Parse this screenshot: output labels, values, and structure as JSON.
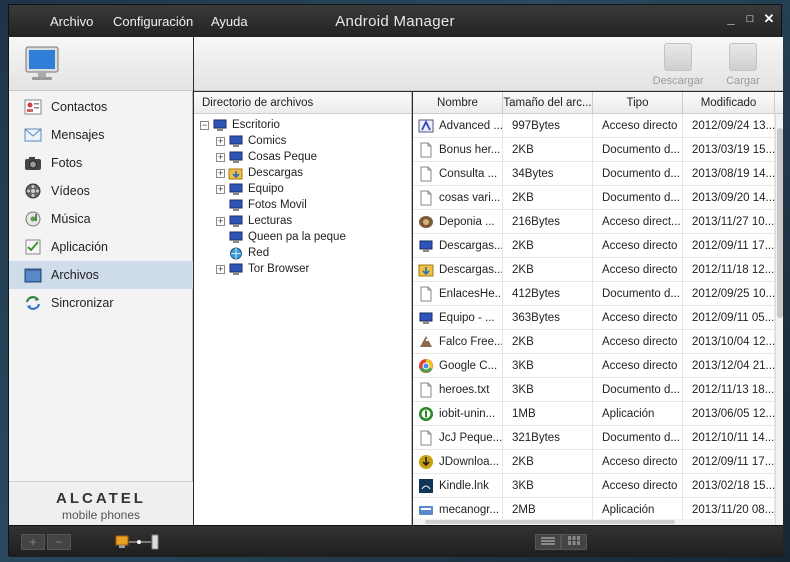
{
  "window": {
    "title": "Android Manager",
    "menu": [
      "Archivo",
      "Configuración",
      "Ayuda"
    ],
    "controls": [
      "_",
      "□",
      "✕"
    ]
  },
  "sidebar": {
    "items": [
      {
        "label": "Contactos",
        "icon": "contacts-icon"
      },
      {
        "label": "Mensajes",
        "icon": "envelope-icon"
      },
      {
        "label": "Fotos",
        "icon": "camera-icon"
      },
      {
        "label": "Vídeos",
        "icon": "film-reel-icon"
      },
      {
        "label": "Música",
        "icon": "music-disc-icon"
      },
      {
        "label": "Aplicación",
        "icon": "checklist-icon"
      },
      {
        "label": "Archivos",
        "icon": "folder-icon",
        "active": true
      },
      {
        "label": "Sincronizar",
        "icon": "sync-icon"
      }
    ],
    "brand": {
      "name": "ALCATEL",
      "sub": "mobile phones"
    }
  },
  "toolbar": {
    "download_label": "Descargar",
    "upload_label": "Cargar"
  },
  "tree": {
    "header": "Directorio de archivos",
    "root": "Escritorio",
    "nodes": [
      {
        "label": "Comics",
        "expandable": true,
        "icon": "computer-icon"
      },
      {
        "label": "Cosas Peque",
        "expandable": true,
        "icon": "computer-icon"
      },
      {
        "label": "Descargas",
        "expandable": true,
        "icon": "folder-download-icon"
      },
      {
        "label": "Equipo",
        "expandable": true,
        "icon": "computer-icon"
      },
      {
        "label": "Fotos Movil",
        "expandable": false,
        "icon": "computer-icon"
      },
      {
        "label": "Lecturas",
        "expandable": true,
        "icon": "computer-icon"
      },
      {
        "label": "Queen pa la peque",
        "expandable": false,
        "icon": "computer-icon"
      },
      {
        "label": "Red",
        "expandable": false,
        "icon": "network-icon"
      },
      {
        "label": "Tor Browser",
        "expandable": true,
        "icon": "computer-icon"
      }
    ]
  },
  "files": {
    "columns": [
      "Nombre",
      "Tamaño del arc...",
      "Tipo",
      "Modificado"
    ],
    "rows": [
      {
        "name": "Advanced ...",
        "size": "997Bytes",
        "type": "Acceso directo",
        "modified": "2012/09/24 13...",
        "icon": "shortcut-app-icon"
      },
      {
        "name": "Bonus her...",
        "size": "2KB",
        "type": "Documento d...",
        "modified": "2013/03/19 15...",
        "icon": "document-icon"
      },
      {
        "name": "Consulta ...",
        "size": "34Bytes",
        "type": "Documento d...",
        "modified": "2013/08/19 14...",
        "icon": "document-icon"
      },
      {
        "name": "cosas vari...",
        "size": "2KB",
        "type": "Documento d...",
        "modified": "2013/09/20 14...",
        "icon": "document-icon"
      },
      {
        "name": "Deponia ...",
        "size": "216Bytes",
        "type": "Acceso direct...",
        "modified": "2013/11/27 10...",
        "icon": "game-icon"
      },
      {
        "name": "Descargas...",
        "size": "2KB",
        "type": "Acceso directo",
        "modified": "2012/09/11 17...",
        "icon": "computer-icon"
      },
      {
        "name": "Descargas...",
        "size": "2KB",
        "type": "Acceso directo",
        "modified": "2012/11/18 12...",
        "icon": "folder-download-icon"
      },
      {
        "name": "EnlacesHe...",
        "size": "412Bytes",
        "type": "Documento d...",
        "modified": "2012/09/25 10...",
        "icon": "document-icon"
      },
      {
        "name": "Equipo - ...",
        "size": "363Bytes",
        "type": "Acceso directo",
        "modified": "2012/09/11 05...",
        "icon": "computer-icon"
      },
      {
        "name": "Falco Free...",
        "size": "2KB",
        "type": "Acceso directo",
        "modified": "2013/10/04 12...",
        "icon": "falcon-icon"
      },
      {
        "name": "Google C...",
        "size": "3KB",
        "type": "Acceso directo",
        "modified": "2013/12/04 21...",
        "icon": "chrome-icon"
      },
      {
        "name": "heroes.txt",
        "size": "3KB",
        "type": "Documento d...",
        "modified": "2012/11/13 18...",
        "icon": "document-icon"
      },
      {
        "name": "iobit-unin...",
        "size": "1MB",
        "type": "Aplicación",
        "modified": "2013/06/05 12...",
        "icon": "uninstaller-icon"
      },
      {
        "name": "JcJ Peque...",
        "size": "321Bytes",
        "type": "Documento d...",
        "modified": "2012/10/11 14...",
        "icon": "document-icon"
      },
      {
        "name": "JDownloa...",
        "size": "2KB",
        "type": "Acceso directo",
        "modified": "2012/09/11 17...",
        "icon": "jdownloader-icon"
      },
      {
        "name": "Kindle.lnk",
        "size": "3KB",
        "type": "Acceso directo",
        "modified": "2013/02/18 15...",
        "icon": "kindle-icon"
      },
      {
        "name": "mecanogr...",
        "size": "2MB",
        "type": "Aplicación",
        "modified": "2013/11/20 08...",
        "icon": "typing-app-icon"
      }
    ]
  },
  "bottom": {
    "add_label": "+",
    "remove_label": "−"
  }
}
